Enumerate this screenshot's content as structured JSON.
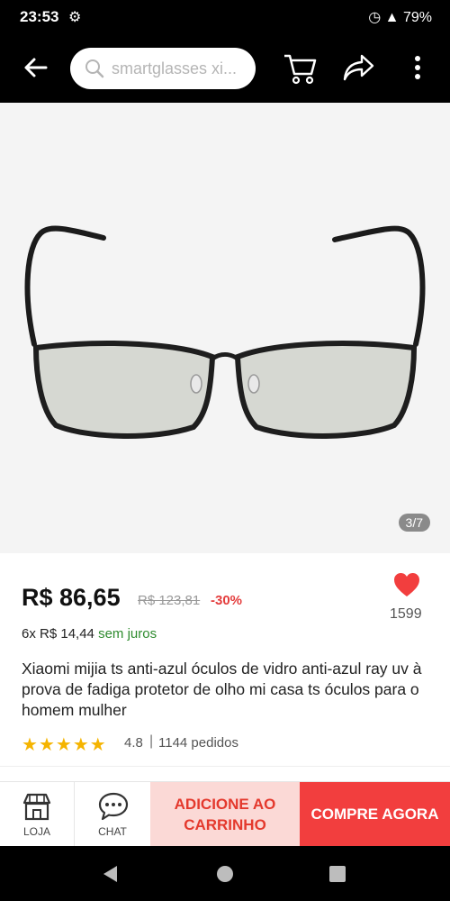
{
  "status_bar": {
    "time": "23:53",
    "battery": "79%"
  },
  "header": {
    "search_placeholder": "smartglasses xi..."
  },
  "gallery": {
    "counter": "3/7"
  },
  "product": {
    "price": "R$ 86,65",
    "original_price": "R$ 123,81",
    "discount": "-30%",
    "likes": "1599",
    "installments": "6x R$ 14,44",
    "installments_note": "sem juros",
    "title": "Xiaomi mijia ts anti-azul óculos de vidro anti-azul ray uv à prova de fadiga protetor de olho mi casa ts óculos para o homem mulher",
    "rating": "4.8",
    "orders": "1144 pedidos"
  },
  "bottom_bar": {
    "store_label": "LOJA",
    "chat_label": "CHAT",
    "add_to_cart": "ADICIONE AO CARRINHO",
    "buy_now": "COMPRE AGORA"
  },
  "colors": {
    "accent": "#f23e3e",
    "add_cart_bg": "#fbd9d6",
    "free_installments": "#2e8b2e",
    "stars": "#f5b400"
  }
}
